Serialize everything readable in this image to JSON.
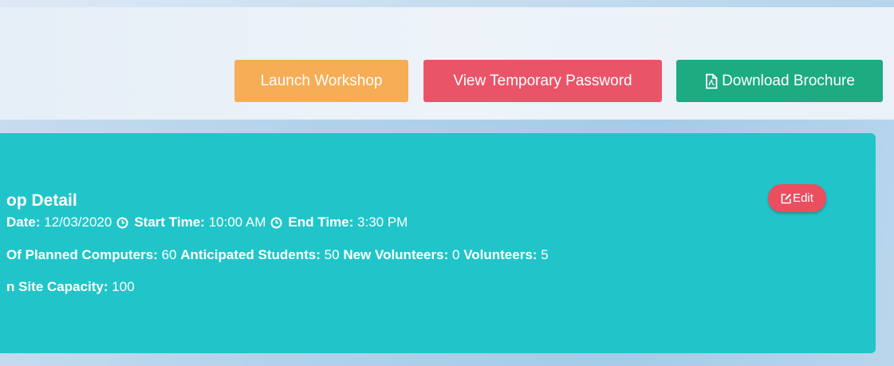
{
  "toolbar": {
    "launch_workshop_label": "Launch Workshop",
    "view_password_label": "View Temporary Password",
    "download_brochure_label": "Download Brochure",
    "download_icon": "pdf-file-icon"
  },
  "workshop": {
    "title": "op Detail",
    "date_label": "Date:",
    "date_value": "12/03/2020",
    "start_time_label": "Start Time:",
    "start_time_value": "10:00 AM",
    "end_time_label": "End Time:",
    "end_time_value": "3:30 PM",
    "planned_computers_label": "Of Planned Computers:",
    "planned_computers_value": "60",
    "anticipated_students_label": "Anticipated Students:",
    "anticipated_students_value": "50",
    "new_volunteers_label": "New Volunteers:",
    "new_volunteers_value": "0",
    "volunteers_label": "Volunteers:",
    "volunteers_value": "5",
    "site_capacity_label": "n Site Capacity:",
    "site_capacity_value": "100",
    "edit_label": "Edit",
    "time_icon": "clock-icon",
    "edit_icon": "edit-icon"
  },
  "colors": {
    "launch": "#f6ad55",
    "password": "#ea5468",
    "brochure": "#1dab82",
    "card": "#21c5c9",
    "edit": "#ea4e5f"
  }
}
